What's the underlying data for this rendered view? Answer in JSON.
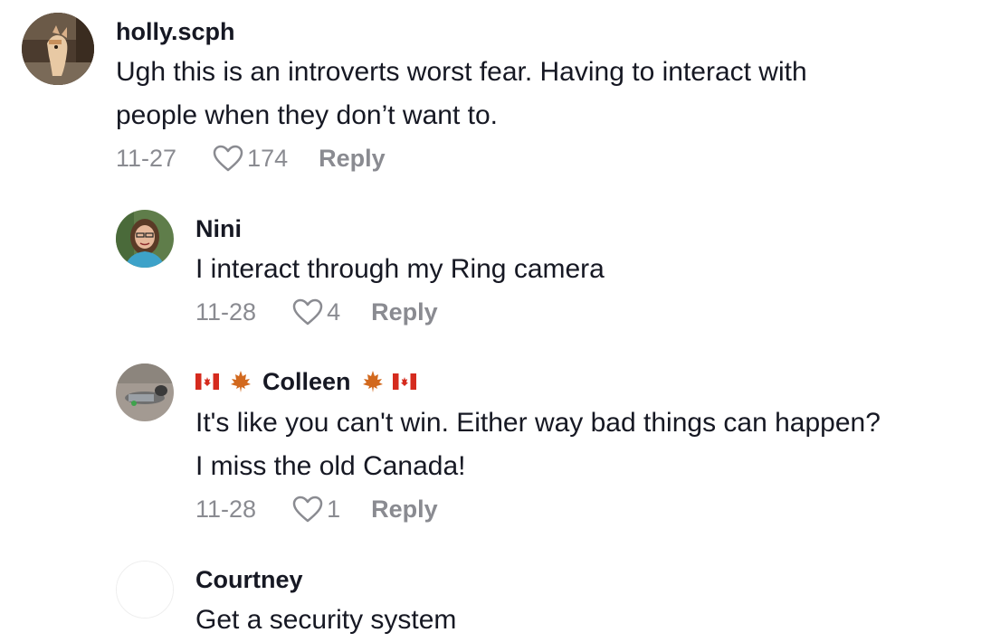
{
  "comments": [
    {
      "username": "holly.scph",
      "lines": [
        "Ugh this is an introverts worst fear. Having to interact with",
        "people when they don’t want to."
      ],
      "date": "11-27",
      "likes": "174",
      "reply_label": "Reply",
      "avatar_icon": "horse-photo-avatar"
    },
    {
      "username": "Nini",
      "lines": [
        "I interact through my Ring camera"
      ],
      "date": "11-28",
      "likes": "4",
      "reply_label": "Reply",
      "avatar_icon": "woman-photo-avatar"
    },
    {
      "username": "Colleen",
      "lines": [
        "It's like you can't win. Either way bad things can happen?",
        "I miss the old Canada!"
      ],
      "date": "11-28",
      "likes": "1",
      "reply_label": "Reply",
      "avatar_icon": "dog-photo-avatar",
      "decorations": [
        "canada-flag-icon",
        "maple-leaf-icon"
      ]
    },
    {
      "username": "Courtney",
      "lines": [
        "Get a security system"
      ],
      "avatar_icon": "blank-avatar"
    }
  ],
  "colors": {
    "text": "#161823",
    "meta": "#8a8b91",
    "canada_red": "#d52b1e",
    "maple_orange": "#d2691e"
  }
}
